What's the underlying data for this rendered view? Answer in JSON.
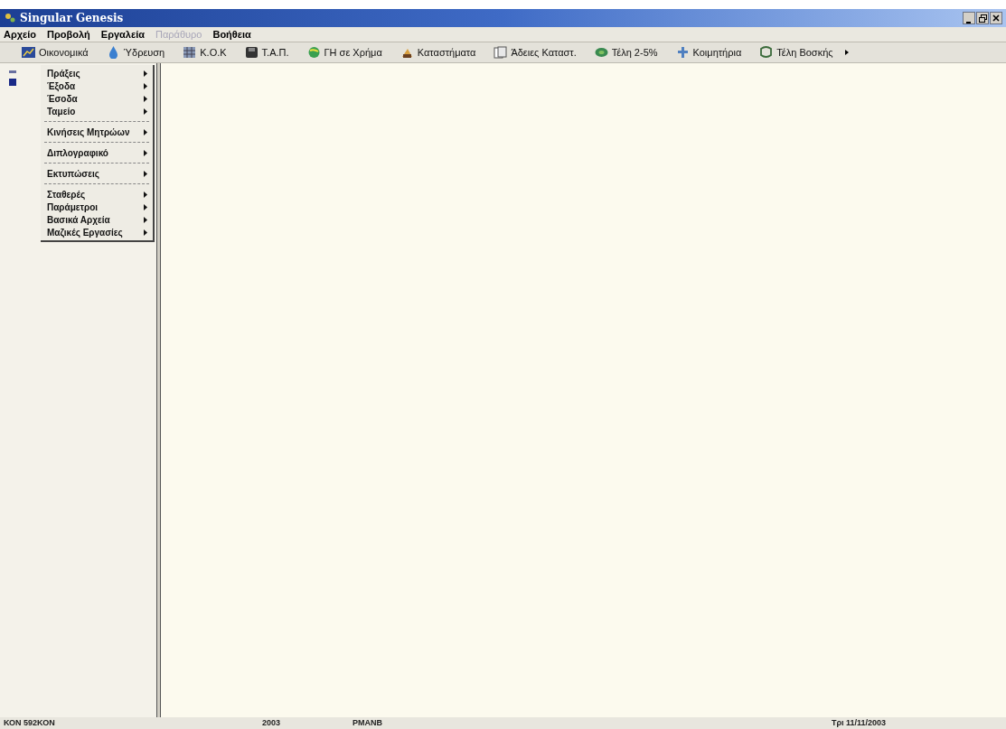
{
  "window": {
    "title": "Singular Genesis"
  },
  "menu_bar": [
    {
      "label": "Αρχείο",
      "disabled": false
    },
    {
      "label": "Προβολή",
      "disabled": false
    },
    {
      "label": "Εργαλεία",
      "disabled": false
    },
    {
      "label": "Παράθυρο",
      "disabled": true
    },
    {
      "label": "Βοήθεια",
      "disabled": false
    }
  ],
  "toolbar": [
    {
      "label": "Οικονομικά"
    },
    {
      "label": "Ύδρευση"
    },
    {
      "label": "Κ.Ο.Κ"
    },
    {
      "label": "Τ.Α.Π."
    },
    {
      "label": "ΓΗ σε Χρήμα"
    },
    {
      "label": "Καταστήματα"
    },
    {
      "label": "Άδειες Καταστ."
    },
    {
      "label": "Τέλη 2-5%"
    },
    {
      "label": "Κοιμητήρια"
    },
    {
      "label": "Τέλη Βοσκής"
    }
  ],
  "popup_menu": {
    "groups": [
      [
        {
          "label": "Πράξεις"
        },
        {
          "label": "Έξοδα"
        },
        {
          "label": "Έσοδα"
        },
        {
          "label": "Ταμείο"
        }
      ],
      [
        {
          "label": "Κινήσεις Μητρώων"
        }
      ],
      [
        {
          "label": "Διπλογραφικό"
        }
      ],
      [
        {
          "label": "Εκτυπώσεις"
        }
      ],
      [
        {
          "label": "Σταθερές"
        },
        {
          "label": "Παράμετροι"
        },
        {
          "label": "Βασικά Αρχεία"
        },
        {
          "label": "Μαζικές Εργασίες"
        }
      ]
    ]
  },
  "status_bar": [
    "ΚΟΝ 592ΚΟΝ",
    "2003",
    "PMANB",
    "Τρι 11/11/2003"
  ]
}
